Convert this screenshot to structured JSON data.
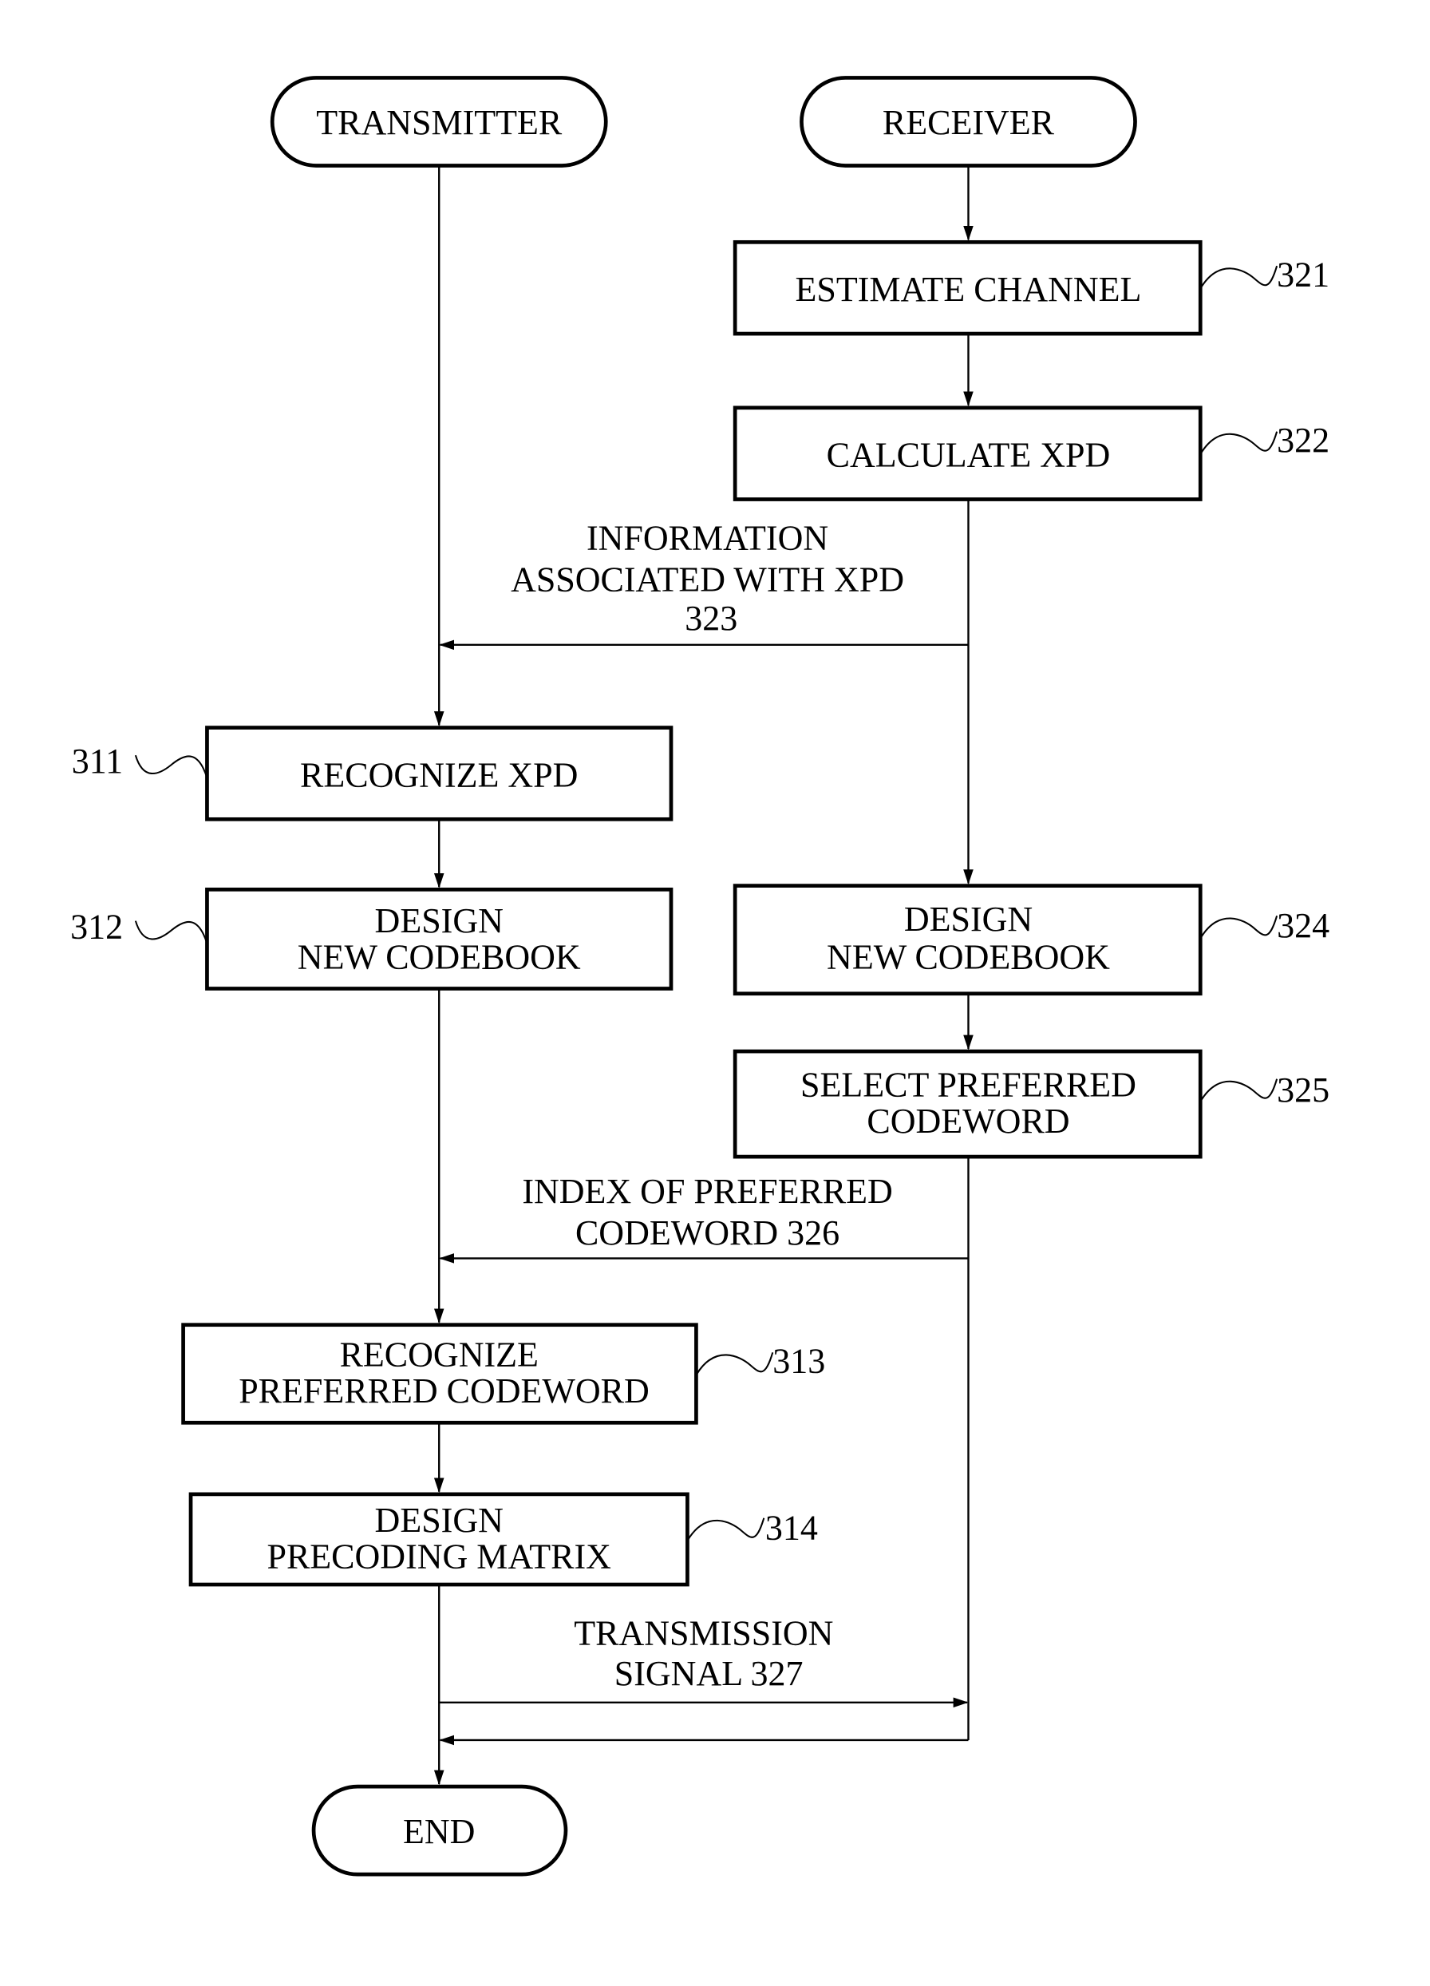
{
  "title": "Transmitter / Receiver codebook flowchart",
  "lanes": {
    "transmitter": "TRANSMITTER",
    "receiver": "RECEIVER",
    "end": "END"
  },
  "receiver_steps": [
    {
      "ref": "321",
      "lines": [
        "ESTIMATE CHANNEL"
      ]
    },
    {
      "ref": "322",
      "lines": [
        "CALCULATE XPD"
      ]
    },
    {
      "ref": "324",
      "lines": [
        "DESIGN",
        "NEW CODEBOOK"
      ]
    },
    {
      "ref": "325",
      "lines": [
        "SELECT PREFERRED",
        "CODEWORD"
      ]
    }
  ],
  "transmitter_steps": [
    {
      "ref": "311",
      "lines": [
        "RECOGNIZE XPD"
      ]
    },
    {
      "ref": "312",
      "lines": [
        "DESIGN",
        "NEW CODEBOOK"
      ]
    },
    {
      "ref": "313",
      "lines": [
        "RECOGNIZE",
        "PREFERRED CODEWORD"
      ]
    },
    {
      "ref": "314",
      "lines": [
        "DESIGN",
        "PRECODING MATRIX"
      ]
    }
  ],
  "messages": [
    {
      "lines": [
        "INFORMATION",
        "ASSOCIATED WITH XPD",
        "323"
      ],
      "direction": "receiver-to-transmitter"
    },
    {
      "lines": [
        "INDEX OF PREFERRED",
        "CODEWORD 326"
      ],
      "direction": "receiver-to-transmitter"
    },
    {
      "lines": [
        "TRANSMISSION",
        "SIGNAL 327"
      ],
      "direction": "transmitter-to-receiver"
    }
  ]
}
